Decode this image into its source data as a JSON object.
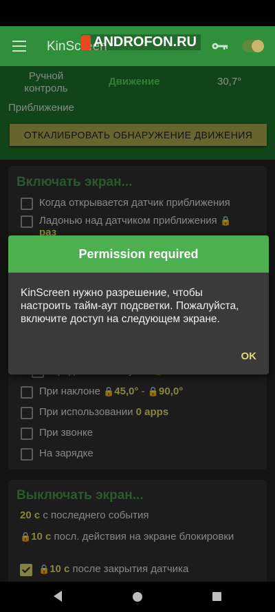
{
  "app": {
    "title": "KinScreen"
  },
  "watermark": {
    "text": "ANDROFON.RU"
  },
  "modes": {
    "manual": "Ручной контроль",
    "motion": "Движение",
    "value": "30,7°",
    "proximity": "Приближение"
  },
  "calibrate_label": "ОТКАЛИБРОВАТЬ ОБНАРУЖЕНИЕ ДВИЖЕНИЯ",
  "turn_on": {
    "title": "Включать экран...",
    "options": {
      "proximity_open": "Когда открывается датчик приближения",
      "palm_over": "Ладонью над датчиком приближения",
      "palm_count": "раз",
      "hidden_partial": "Продлите таймаут на",
      "tilt_prefix": "При наклоне",
      "tilt_from": "45,0°",
      "tilt_sep": " - ",
      "tilt_to": "90,0°",
      "use_prefix": "При использовании",
      "use_apps": "0 apps",
      "call": "При звонке",
      "charging": "На зарядке"
    }
  },
  "turn_off": {
    "title": "Выключать экран...",
    "last_event_value": "20 с",
    "last_event_text": " с последнего события",
    "lock_value": "10 с",
    "lock_text": " посл. действия на экране блокировки",
    "close_value": "10 с",
    "close_text": " после закрытия датчика"
  },
  "dialog": {
    "title": "Permission required",
    "message": "KinScreen нужно разрешение, чтобы настроить тайм-аут подсветки. Пожалуйста, включите доступ на следующем экране.",
    "ok_label": "OK"
  }
}
